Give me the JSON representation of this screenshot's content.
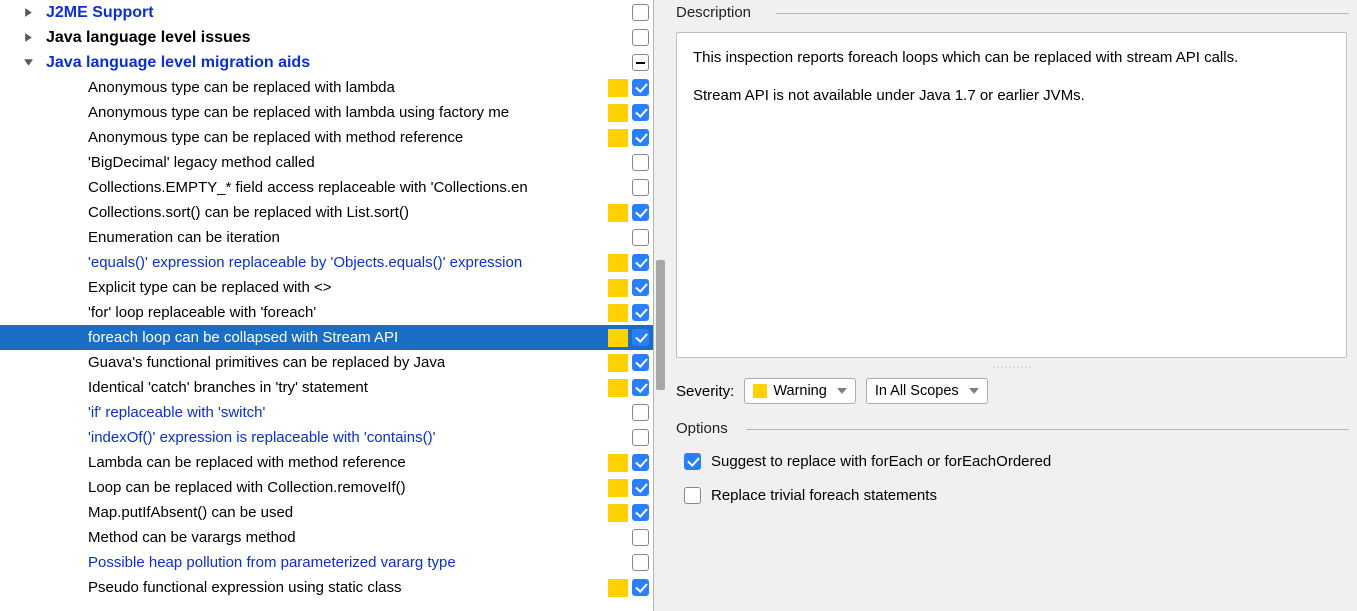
{
  "tree": {
    "groups": [
      {
        "label": "J2ME Support",
        "expanded": false,
        "blue": true,
        "checkbox": "off"
      },
      {
        "label": "Java language level issues",
        "expanded": false,
        "blue": false,
        "checkbox": "off"
      },
      {
        "label": "Java language level migration aids",
        "expanded": true,
        "blue": true,
        "checkbox": "minus"
      }
    ],
    "items": [
      {
        "label": "Anonymous type can be replaced with lambda",
        "marker": true,
        "checked": true,
        "link": false
      },
      {
        "label": "Anonymous type can be replaced with lambda using factory me",
        "marker": true,
        "checked": true,
        "link": false
      },
      {
        "label": "Anonymous type can be replaced with method reference",
        "marker": true,
        "checked": true,
        "link": false
      },
      {
        "label": "'BigDecimal' legacy method called",
        "marker": false,
        "checked": false,
        "link": false
      },
      {
        "label": "Collections.EMPTY_* field access replaceable with 'Collections.en",
        "marker": false,
        "checked": false,
        "link": false
      },
      {
        "label": "Collections.sort() can be replaced with List.sort()",
        "marker": true,
        "checked": true,
        "link": false
      },
      {
        "label": "Enumeration can be iteration",
        "marker": false,
        "checked": false,
        "link": false
      },
      {
        "label": "'equals()' expression replaceable by 'Objects.equals()' expression",
        "marker": true,
        "checked": true,
        "link": true
      },
      {
        "label": "Explicit type can be replaced with <>",
        "marker": true,
        "checked": true,
        "link": false
      },
      {
        "label": "'for' loop replaceable with 'foreach'",
        "marker": true,
        "checked": true,
        "link": false
      },
      {
        "label": "foreach loop can be collapsed with Stream API",
        "marker": true,
        "checked": true,
        "link": false,
        "selected": true
      },
      {
        "label": "Guava's functional primitives can be replaced by Java",
        "marker": true,
        "checked": true,
        "link": false
      },
      {
        "label": "Identical 'catch' branches in 'try' statement",
        "marker": true,
        "checked": true,
        "link": false
      },
      {
        "label": "'if' replaceable with 'switch'",
        "marker": false,
        "checked": false,
        "link": true
      },
      {
        "label": "'indexOf()' expression is replaceable with 'contains()'",
        "marker": false,
        "checked": false,
        "link": true
      },
      {
        "label": "Lambda can be replaced with method reference",
        "marker": true,
        "checked": true,
        "link": false
      },
      {
        "label": "Loop can be replaced with Collection.removeIf()",
        "marker": true,
        "checked": true,
        "link": false
      },
      {
        "label": "Map.putIfAbsent() can be used",
        "marker": true,
        "checked": true,
        "link": false
      },
      {
        "label": "Method can be varargs method",
        "marker": false,
        "checked": false,
        "link": false
      },
      {
        "label": "Possible heap pollution from parameterized vararg type",
        "marker": false,
        "checked": false,
        "link": true
      },
      {
        "label": "Pseudo functional expression using static class",
        "marker": true,
        "checked": true,
        "link": false
      }
    ]
  },
  "desc": {
    "title": "Description",
    "p1": "This inspection reports foreach loops which can be replaced with stream API calls.",
    "p2": "Stream API is not available under Java 1.7 or earlier JVMs."
  },
  "severity": {
    "label": "Severity:",
    "level": "Warning",
    "scope": "In All Scopes"
  },
  "options": {
    "title": "Options",
    "opt1": {
      "label": "Suggest to replace with forEach or forEachOrdered",
      "checked": true
    },
    "opt2": {
      "label": "Replace trivial foreach statements",
      "checked": false
    }
  }
}
